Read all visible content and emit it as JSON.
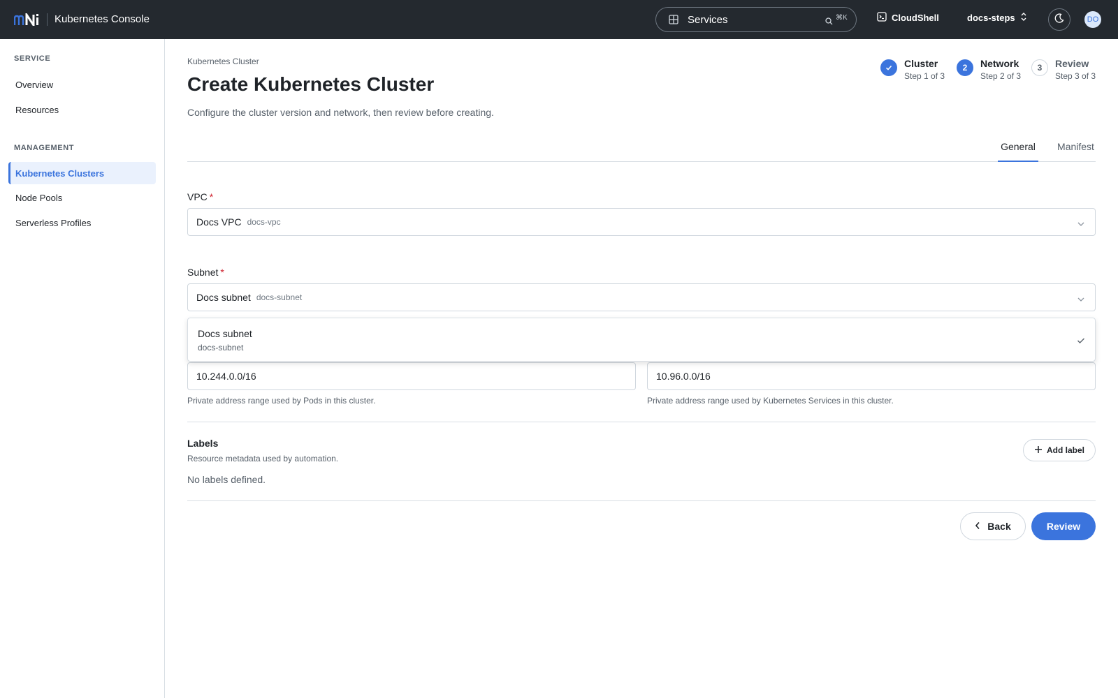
{
  "topbar": {
    "logo_text": "mNi",
    "app_title": "Kubernetes Console",
    "search_label": "Services",
    "search_shortcut": "⌘K",
    "cloudshell_label": "CloudShell",
    "project_label": "docs-steps",
    "avatar_initials": "DO",
    "icons": [
      "grid-icon",
      "search-icon",
      "terminal-icon",
      "chevron-up-down-icon",
      "moon-icon"
    ]
  },
  "sidebar": {
    "sections": [
      {
        "title": "SERVICE",
        "items": [
          {
            "label": "Overview"
          },
          {
            "label": "Resources"
          }
        ]
      },
      {
        "title": "MANAGEMENT",
        "items": [
          {
            "label": "Kubernetes Clusters",
            "active": true
          },
          {
            "label": "Node Pools"
          },
          {
            "label": "Serverless Profiles"
          }
        ]
      }
    ]
  },
  "page": {
    "breadcrumb": "Kubernetes Cluster",
    "title": "Create Kubernetes Cluster",
    "description": "Configure the cluster version and network, then review before creating."
  },
  "stepper": [
    {
      "name": "Cluster",
      "sub": "Step 1 of 3",
      "state": "done",
      "number": "1"
    },
    {
      "name": "Network",
      "sub": "Step 2 of 3",
      "state": "current",
      "number": "2"
    },
    {
      "name": "Review",
      "sub": "Step 3 of 3",
      "state": "todo",
      "number": "3"
    }
  ],
  "tabs": [
    {
      "label": "General",
      "active": true
    },
    {
      "label": "Manifest"
    }
  ],
  "form": {
    "vpc": {
      "label": "VPC",
      "required": "*",
      "value": "Docs VPC",
      "value_id": "docs-vpc"
    },
    "subnet": {
      "label": "Subnet",
      "required": "*",
      "value": "Docs subnet",
      "value_id": "docs-subnet"
    },
    "subnet_dropdown": {
      "option_label": "Docs subnet",
      "option_id": "docs-subnet",
      "selected": true
    },
    "pod_cidr": {
      "value": "10.244.0.0/16",
      "help": "Private address range used by Pods in this cluster."
    },
    "service_cidr": {
      "value": "10.96.0.0/16",
      "help": "Private address range used by Kubernetes Services in this cluster."
    }
  },
  "labels": {
    "title": "Labels",
    "description": "Resource metadata used by automation.",
    "empty_text": "No labels defined.",
    "add_button": "Add label"
  },
  "actions": {
    "back": "Back",
    "review": "Review"
  },
  "colors": {
    "accent": "#3b74dd",
    "topbar": "#24292f",
    "required": "#cf222e"
  }
}
